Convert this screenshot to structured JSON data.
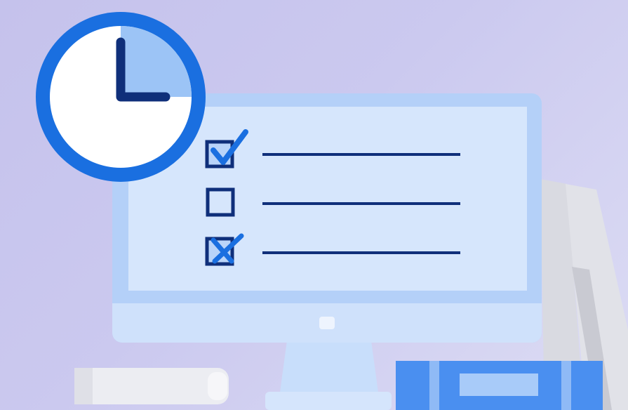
{
  "illustration": {
    "subject": "checklist-monitor-with-clock",
    "checklist": {
      "items": [
        {
          "state": "checked"
        },
        {
          "state": "unchecked"
        },
        {
          "state": "crossed"
        }
      ]
    },
    "icons": [
      "clock-icon",
      "monitor-icon",
      "checkbox-checked-icon",
      "checkbox-empty-icon",
      "checkbox-crossed-icon",
      "book-icon"
    ],
    "colors": {
      "background": "#c8c5ee",
      "clock_ring": "#1a6fe0",
      "clock_hands": "#0f2f7a",
      "clock_shade": "#9cc4f6",
      "screen_frame": "#a8c9f6",
      "screen": "#d6e6fc",
      "checkbox_outline": "#0f2f7a",
      "check_accent": "#1a6fe0",
      "text_lines": "#0f2f7a",
      "stand": "#c8defb",
      "book_blue": "#4a8ff0",
      "book_light": "#ecedf2",
      "panels_gray": "#dcdde3"
    }
  }
}
